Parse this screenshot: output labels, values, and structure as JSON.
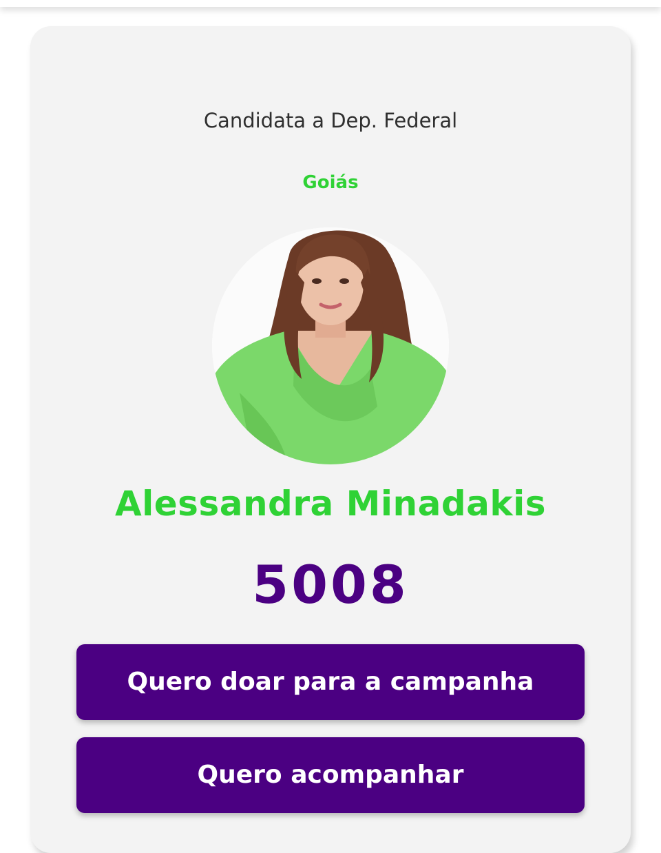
{
  "card": {
    "role": "Candidata a Dep. Federal",
    "state": "Goiás",
    "candidate_name": "Alessandra Minadakis",
    "candidate_number": "5008",
    "photo_icon": "candidate-portrait"
  },
  "buttons": {
    "donate_label": "Quero doar para a campanha",
    "follow_label": "Quero acompanhar"
  },
  "colors": {
    "accent_green": "#2fd235",
    "brand_purple": "#4b0082",
    "card_background": "#f3f3f3",
    "text_dark": "#2f2f2f"
  }
}
